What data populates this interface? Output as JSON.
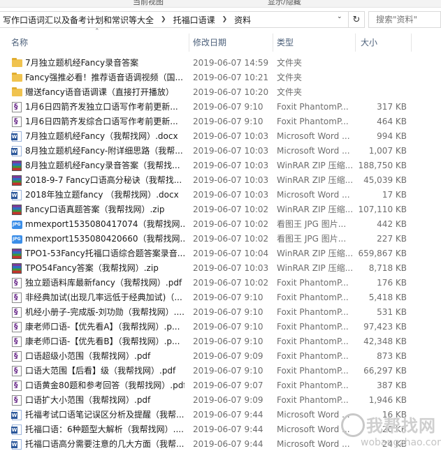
{
  "window": {
    "top_tabs": [
      "当前视图",
      "显示/隐藏"
    ]
  },
  "address": {
    "crumbs": [
      "写作口语词汇以及备考计划和常识等大全",
      "托福口语课",
      "资料"
    ],
    "search_placeholder": "搜索\"资料\""
  },
  "columns": {
    "name": "名称",
    "date": "修改日期",
    "type": "类型",
    "size": "大小"
  },
  "files": [
    {
      "icon": "folder",
      "name": "7月独立题机经Fancy录音答案",
      "date": "2019-06-07 14:59",
      "type": "文件夹",
      "size": ""
    },
    {
      "icon": "folder",
      "name": "Fancy强推必看！推荐语音语调视频（国...",
      "date": "2019-06-07 10:21",
      "type": "文件夹",
      "size": ""
    },
    {
      "icon": "folder",
      "name": "赠送fancy语音语调课（直接打开播放）",
      "date": "2019-06-07 10:20",
      "type": "文件夹",
      "size": ""
    },
    {
      "icon": "pdf",
      "name": "1月6日四箭齐发独立口语写作考前更新...",
      "date": "2019-06-07 9:10",
      "type": "Foxit PhantomP...",
      "size": "317 KB"
    },
    {
      "icon": "pdf",
      "name": "1月6日四箭齐发综合口语写作考前更新...",
      "date": "2019-06-07 9:10",
      "type": "Foxit PhantomP...",
      "size": "464 KB"
    },
    {
      "icon": "word",
      "name": "7月独立题机经Fancy（我帮找网）.docx",
      "date": "2019-06-07 10:03",
      "type": "Microsoft Word ...",
      "size": "994 KB"
    },
    {
      "icon": "word",
      "name": "8月独立题机经Fancy-附详细思路（我帮...",
      "date": "2019-06-07 10:03",
      "type": "Microsoft Word ...",
      "size": "1,007 KB"
    },
    {
      "icon": "rar",
      "name": "8月独立题机经Fancy录音答案（我帮找...",
      "date": "2019-06-07 10:03",
      "type": "WinRAR ZIP 压缩...",
      "size": "188,750 KB"
    },
    {
      "icon": "rar",
      "name": "2018-9-7 Fancy口语高分秘诀（我帮找...",
      "date": "2019-06-07 10:03",
      "type": "WinRAR ZIP 压缩...",
      "size": "45,039 KB"
    },
    {
      "icon": "word",
      "name": "2018年独立题fancy （我帮找网）.docx",
      "date": "2019-06-07 10:03",
      "type": "Microsoft Word ...",
      "size": "17 KB"
    },
    {
      "icon": "rar",
      "name": "Fancy口语真题答案（我帮找网）.zip",
      "date": "2019-06-07 10:02",
      "type": "WinRAR ZIP 压缩...",
      "size": "107,110 KB"
    },
    {
      "icon": "jpg",
      "name": "mmexport1535080417074（我帮找网...",
      "date": "2019-06-07 10:02",
      "type": "看图王 JPG 图片...",
      "size": "442 KB"
    },
    {
      "icon": "jpg",
      "name": "mmexport1535080420660（我帮找网...",
      "date": "2019-06-07 10:02",
      "type": "看图王 JPG 图片...",
      "size": "227 KB"
    },
    {
      "icon": "rar",
      "name": "TPO1-53Fancy托福口语综合题答案录音...",
      "date": "2019-06-07 10:04",
      "type": "WinRAR ZIP 压缩...",
      "size": "659,867 KB"
    },
    {
      "icon": "rar",
      "name": "TPO54Fancy答案（我帮找网）.zip",
      "date": "2019-06-07 10:03",
      "type": "WinRAR ZIP 压缩...",
      "size": "8,718 KB"
    },
    {
      "icon": "pdf",
      "name": "独立题语料库最新fancy（我帮找网）.pdf",
      "date": "2019-06-07 10:02",
      "type": "Foxit PhantomP...",
      "size": "176 KB"
    },
    {
      "icon": "pdf",
      "name": "非经典加试(出现几率远低于经典加试)（...",
      "date": "2019-06-07 9:10",
      "type": "Foxit PhantomP...",
      "size": "5,418 KB"
    },
    {
      "icon": "pdf",
      "name": "机经小册子-完成版-刘功勋（我帮找网）....",
      "date": "2019-06-07 9:10",
      "type": "Foxit PhantomP...",
      "size": "531 KB"
    },
    {
      "icon": "pdf",
      "name": "康老师口语-【优先看A】（我帮找网）.p...",
      "date": "2019-06-07 9:10",
      "type": "Foxit PhantomP...",
      "size": "97,423 KB"
    },
    {
      "icon": "pdf",
      "name": "康老师口语-【优先看B】（我帮找网）.p...",
      "date": "2019-06-07 9:10",
      "type": "Foxit PhantomP...",
      "size": "42,348 KB"
    },
    {
      "icon": "pdf",
      "name": "口语超级小范围（我帮找网）.pdf",
      "date": "2019-06-07 9:09",
      "type": "Foxit PhantomP...",
      "size": "873 KB"
    },
    {
      "icon": "pdf",
      "name": "口语大范围【后看】级（我帮找网）.pdf",
      "date": "2019-06-07 9:10",
      "type": "Foxit PhantomP...",
      "size": "66,297 KB"
    },
    {
      "icon": "pdf",
      "name": "口语黄金80题和参考回答（我帮找网）.pdf",
      "date": "2019-06-07 9:07",
      "type": "Foxit PhantomP...",
      "size": "387 KB"
    },
    {
      "icon": "pdf",
      "name": "口语扩大小范围（我帮找网）.pdf",
      "date": "2019-06-07 9:09",
      "type": "Foxit PhantomP...",
      "size": "1,946 KB"
    },
    {
      "icon": "word",
      "name": "托福考试口语笔记误区分析及提醒（我帮...",
      "date": "2019-06-07 9:44",
      "type": "Microsoft Word ...",
      "size": "16 KB"
    },
    {
      "icon": "word",
      "name": "托福口语：6种题型大解析（我帮找网）....",
      "date": "2019-06-07 9:44",
      "type": "Microsoft Word ...",
      "size": "20 KB"
    },
    {
      "icon": "word",
      "name": "托福口语高分需要注意的几大方面（我帮...",
      "date": "2019-06-07 9:44",
      "type": "Microsoft Word ...",
      "size": "24 KB"
    }
  ],
  "watermark": {
    "text": "我帮找网",
    "url": "wobangzhao.com"
  }
}
